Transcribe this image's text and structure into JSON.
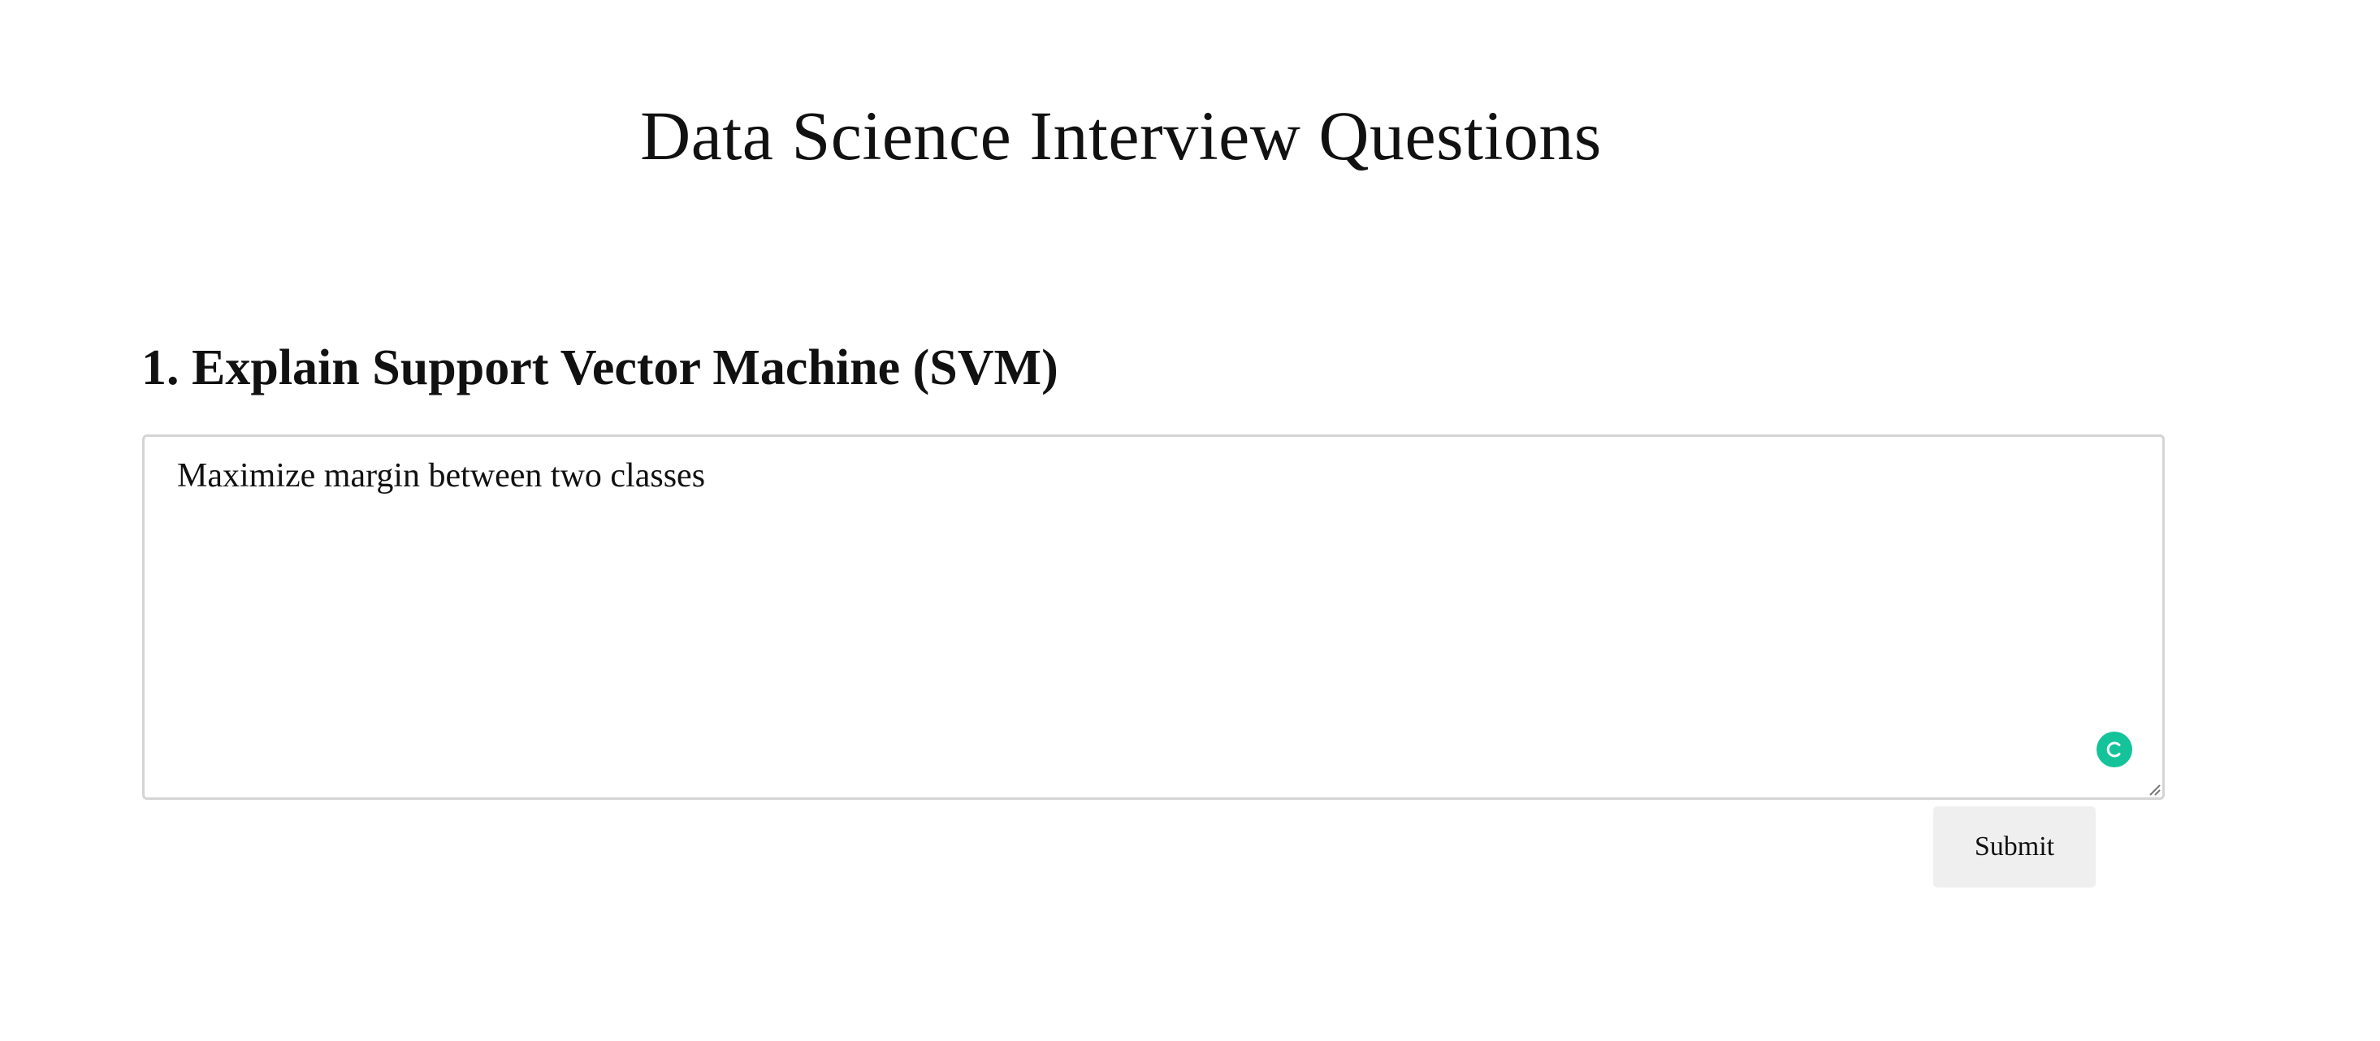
{
  "page": {
    "title": "Data Science Interview Questions"
  },
  "question": {
    "heading": "1. Explain Support Vector Machine (SVM)",
    "answer_value": "Maximize margin between two classes"
  },
  "actions": {
    "submit_label": "Submit"
  },
  "icons": {
    "assist_badge": "grammar-assistant-icon",
    "resize": "resize-grip-icon"
  },
  "colors": {
    "assist_badge": "#15c39a",
    "button_background": "#efefef",
    "textarea_border": "#d4d4d4"
  }
}
